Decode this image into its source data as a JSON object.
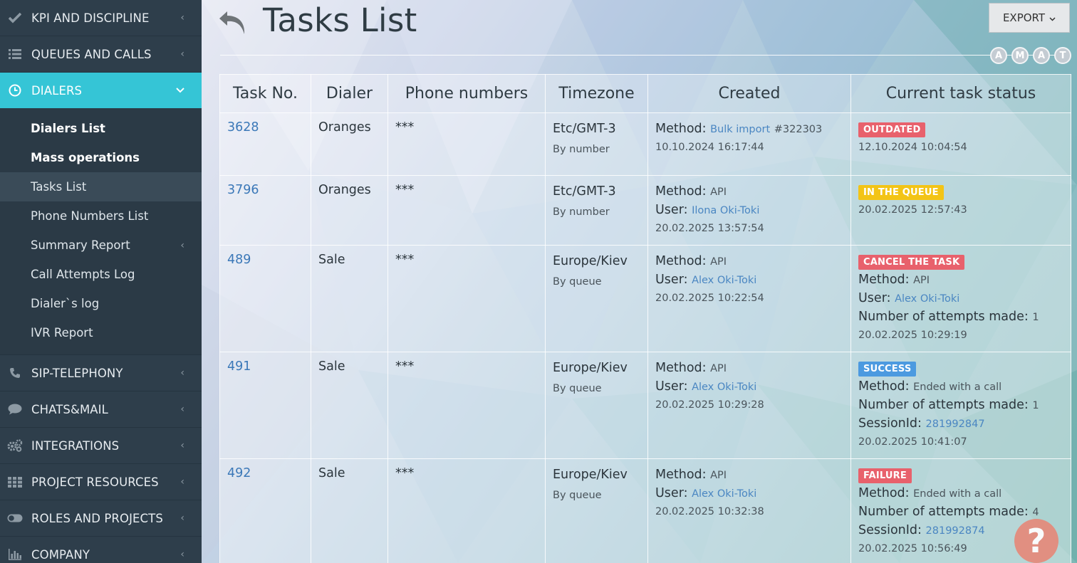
{
  "sidebar": {
    "items_top": [
      {
        "label": "KPI AND DISCIPLINE",
        "icon": "check-icon"
      },
      {
        "label": "QUEUES AND CALLS",
        "icon": "list-icon"
      }
    ],
    "active": {
      "label": "DIALERS",
      "icon": "clock-icon"
    },
    "submenu": [
      {
        "label": "Dialers List"
      },
      {
        "label": "Mass operations"
      },
      {
        "label": "Tasks List"
      },
      {
        "label": "Phone Numbers List"
      },
      {
        "label": "Summary Report"
      },
      {
        "label": "Call Attempts Log"
      },
      {
        "label": "Dialer`s log"
      },
      {
        "label": "IVR Report"
      }
    ],
    "items_bottom": [
      {
        "label": "SIP-TELEPHONY",
        "icon": "phone-icon"
      },
      {
        "label": "CHATS&MAIL",
        "icon": "chat-bubble-icon"
      },
      {
        "label": "INTEGRATIONS",
        "icon": "gears-icon"
      },
      {
        "label": "PROJECT RESOURCES",
        "icon": "grid-icon"
      },
      {
        "label": "ROLES AND PROJECTS",
        "icon": "toggle-icon"
      },
      {
        "label": "COMPANY",
        "icon": "bar-chart-icon"
      }
    ]
  },
  "header": {
    "title": "Tasks List",
    "export_label": "EXPORT",
    "avatars": [
      "A",
      "M",
      "A",
      "T"
    ]
  },
  "table": {
    "columns": [
      "Task No.",
      "Dialer",
      "Phone numbers",
      "Timezone",
      "Created",
      "Current task status"
    ],
    "rows": [
      {
        "task_no": "3628",
        "dialer": "Oranges",
        "phones": "***",
        "tz": "Etc/GMT-3",
        "tz_mode": "By number",
        "created": {
          "method_label": "Method:",
          "method": "Bulk import",
          "method_extra": "#322303",
          "user_label": "",
          "user": "",
          "date": "10.10.2024 16:17:44"
        },
        "status": {
          "badge": "OUTDATED",
          "color": "#e8616c",
          "method": "",
          "user": "",
          "attempts": "",
          "session": "",
          "date": "12.10.2024 10:04:54"
        }
      },
      {
        "task_no": "3796",
        "dialer": "Oranges",
        "phones": "***",
        "tz": "Etc/GMT-3",
        "tz_mode": "By number",
        "created": {
          "method_label": "Method:",
          "method": "API",
          "method_extra": "",
          "user_label": "User:",
          "user": "Ilona Oki-Toki",
          "date": "20.02.2025 13:57:54"
        },
        "status": {
          "badge": "IN THE QUEUE",
          "color": "#f3c416",
          "method": "",
          "user": "",
          "attempts": "",
          "session": "",
          "date": "20.02.2025 12:57:43"
        }
      },
      {
        "task_no": "489",
        "dialer": "Sale",
        "phones": "***",
        "tz": "Europe/Kiev",
        "tz_mode": "By queue",
        "created": {
          "method_label": "Method:",
          "method": "API",
          "method_extra": "",
          "user_label": "User:",
          "user": "Alex Oki-Toki",
          "date": "20.02.2025 10:22:54"
        },
        "status": {
          "badge": "CANCEL THE TASK",
          "color": "#e8616c",
          "method": "API",
          "user": "Alex Oki-Toki",
          "attempts": "1",
          "session": "",
          "date": "20.02.2025 10:29:19"
        }
      },
      {
        "task_no": "491",
        "dialer": "Sale",
        "phones": "***",
        "tz": "Europe/Kiev",
        "tz_mode": "By queue",
        "created": {
          "method_label": "Method:",
          "method": "API",
          "method_extra": "",
          "user_label": "User:",
          "user": "Alex Oki-Toki",
          "date": "20.02.2025 10:29:28"
        },
        "status": {
          "badge": "SUCCESS",
          "color": "#4c9ae0",
          "method": "Ended with a call",
          "user": "",
          "attempts": "1",
          "session": "281992847",
          "date": "20.02.2025 10:41:07"
        }
      },
      {
        "task_no": "492",
        "dialer": "Sale",
        "phones": "***",
        "tz": "Europe/Kiev",
        "tz_mode": "By queue",
        "created": {
          "method_label": "Method:",
          "method": "API",
          "method_extra": "",
          "user_label": "User:",
          "user": "Alex Oki-Toki",
          "date": "20.02.2025 10:32:38"
        },
        "status": {
          "badge": "FAILURE",
          "color": "#e8616c",
          "method": "Ended with a call",
          "user": "",
          "attempts": "4",
          "session": "281992874",
          "date": "20.02.2025 10:56:49"
        }
      }
    ],
    "labels": {
      "method": "Method:",
      "user": "User:",
      "attempts": "Number of attempts made:",
      "session": "SessionId:"
    }
  },
  "help": {
    "label": "?"
  }
}
